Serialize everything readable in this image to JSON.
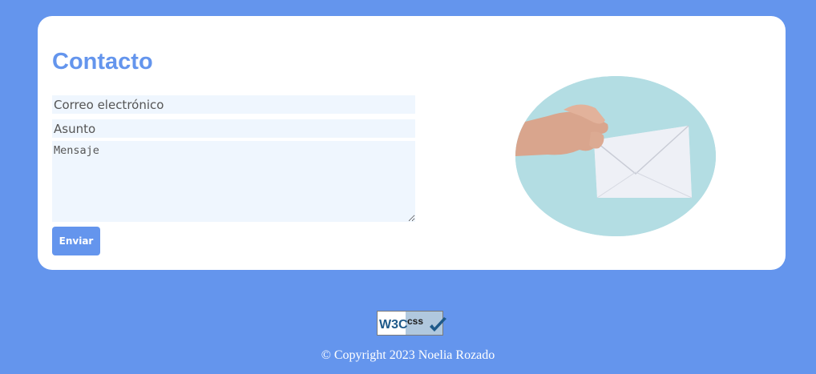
{
  "contact": {
    "title": "Contacto",
    "email_placeholder": "Correo electrónico",
    "subject_placeholder": "Asunto",
    "message_placeholder": "Mensaje",
    "send_label": "Enviar"
  },
  "image": {
    "icon": "hand-holding-envelope-photo"
  },
  "footer": {
    "badge": {
      "w3c": "W3C",
      "css": "css",
      "icon": "checkmark-icon"
    },
    "copyright": "© Copyright 2023 Noelia Rozado"
  },
  "colors": {
    "background": "#6495ed",
    "card": "#ffffff",
    "field": "#eff6fe",
    "accent": "#6495ed"
  }
}
